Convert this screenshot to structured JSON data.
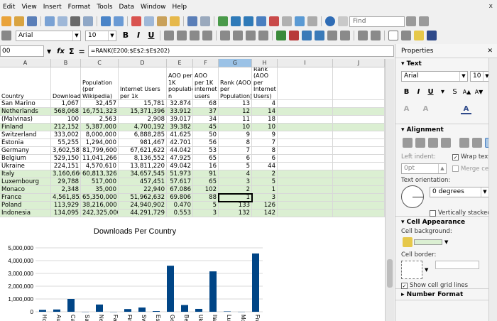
{
  "menu": [
    "Edit",
    "View",
    "Insert",
    "Format",
    "Tools",
    "Data",
    "Window",
    "Help"
  ],
  "window_controls": "x",
  "toolbar": {
    "find_placeholder": "Find",
    "font_name": "Arial",
    "font_size": "10"
  },
  "formula_bar": {
    "name_box": "00",
    "formula": "=RANK(E200;$E$2:$E$202)",
    "fx": "fx",
    "sigma": "Σ",
    "equals": "="
  },
  "sheet": {
    "columns": [
      "A",
      "B",
      "C",
      "D",
      "E",
      "F",
      "G",
      "H",
      "I",
      "J"
    ],
    "header_row": [
      "Country",
      "Downloads",
      "Population (per Wikipedia)",
      "Internet Users per 1k",
      "AOO per 1K populatio n",
      "AOO per 1K internet users",
      "Rank (AOO per Population)",
      "Rank (AOO per Internet Users)"
    ],
    "rows": [
      {
        "country": "San Marino",
        "downloads": "1,067",
        "population": "32,457",
        "internet": "15,781",
        "aoo_pop": "32.874",
        "aoo_net": "68",
        "rank_pop": "13",
        "rank_net": "4",
        "band": false
      },
      {
        "country": "Netherlands",
        "downloads": "568,068",
        "population": "16,751,323",
        "internet": "15,371,396",
        "aoo_pop": "33.912",
        "aoo_net": "37",
        "rank_pop": "12",
        "rank_net": "14",
        "band": true
      },
      {
        "country": "(Malvinas)",
        "downloads": "100",
        "population": "2,563",
        "internet": "2,908",
        "aoo_pop": "39.017",
        "aoo_net": "34",
        "rank_pop": "11",
        "rank_net": "18",
        "band": false
      },
      {
        "country": "Finland",
        "downloads": "212,152",
        "population": "5,387,000",
        "internet": "4,700,192",
        "aoo_pop": "39.382",
        "aoo_net": "45",
        "rank_pop": "10",
        "rank_net": "10",
        "band": true
      },
      {
        "country": "Switzerland",
        "downloads": "333,002",
        "population": "8,000,000",
        "internet": "6,888,285",
        "aoo_pop": "41.625",
        "aoo_net": "50",
        "rank_pop": "9",
        "rank_net": "9",
        "band": false
      },
      {
        "country": "Estonia",
        "downloads": "55,255",
        "population": "1,294,000",
        "internet": "981,467",
        "aoo_pop": "42.701",
        "aoo_net": "56",
        "rank_pop": "8",
        "rank_net": "7",
        "band": false
      },
      {
        "country": "Germany",
        "downloads": "3,602,587",
        "population": "81,799,600",
        "internet": "67,621,622",
        "aoo_pop": "44.042",
        "aoo_net": "53",
        "rank_pop": "7",
        "rank_net": "8",
        "band": false
      },
      {
        "country": "Belgium",
        "downloads": "529,150",
        "population": "11,041,266",
        "internet": "8,136,552",
        "aoo_pop": "47.925",
        "aoo_net": "65",
        "rank_pop": "6",
        "rank_net": "6",
        "band": false
      },
      {
        "country": "Ukraine",
        "downloads": "224,151",
        "population": "4,570,610",
        "internet": "13,811,220",
        "aoo_pop": "49.042",
        "aoo_net": "16",
        "rank_pop": "5",
        "rank_net": "44",
        "band": false
      },
      {
        "country": "Italy",
        "downloads": "3,160,660",
        "population": "60,813,326",
        "internet": "34,657,545",
        "aoo_pop": "51.973",
        "aoo_net": "91",
        "rank_pop": "4",
        "rank_net": "2",
        "band": true
      },
      {
        "country": "Luxembourg",
        "downloads": "29,788",
        "population": "517,000",
        "internet": "457,451",
        "aoo_pop": "57.617",
        "aoo_net": "65",
        "rank_pop": "3",
        "rank_net": "5",
        "band": true
      },
      {
        "country": "Monaco",
        "downloads": "2,348",
        "population": "35,000",
        "internet": "22,940",
        "aoo_pop": "67.086",
        "aoo_net": "102",
        "rank_pop": "2",
        "rank_net": "1",
        "band": true
      },
      {
        "country": "France",
        "downloads": "4,561,852",
        "population": "65,350,000",
        "internet": "51,962,632",
        "aoo_pop": "69.806",
        "aoo_net": "88",
        "rank_pop": "1",
        "rank_net": "3",
        "band": true
      },
      {
        "country": "Poland",
        "downloads": "113,929",
        "population": "38,216,000",
        "internet": "24,940,902",
        "aoo_pop": "0.470",
        "aoo_net": "5",
        "rank_pop": "133",
        "rank_net": "126",
        "band": true
      },
      {
        "country": "Indonesia",
        "downloads": "134,095",
        "population": "242,325,000",
        "internet": "44,291,729",
        "aoo_pop": "0.553",
        "aoo_net": "3",
        "rank_pop": "132",
        "rank_net": "142",
        "band": true
      }
    ]
  },
  "chart_data": {
    "type": "bar",
    "title": "Downloads Per Country",
    "categories": [
      "Hong",
      "Austr",
      "Carac",
      "San M",
      "Nethe",
      "Falkl",
      "Finlar",
      "Switz",
      "Eston",
      "Germ",
      "Belgi",
      "Ukrai",
      "Italy",
      "Luxer",
      "Mona",
      "Franc"
    ],
    "values": [
      150000,
      180000,
      1000000,
      1067,
      568068,
      100,
      212152,
      333002,
      55255,
      3602587,
      529150,
      224151,
      3160660,
      29788,
      2348,
      4561852
    ],
    "ylim": [
      0,
      5000000
    ],
    "yticks": [
      "0",
      "1,000,000",
      "2,000,000",
      "3,000,000",
      "4,000,000",
      "5,000,000"
    ],
    "grid": true,
    "color": "#004586"
  },
  "sidebar": {
    "title": "Properties",
    "text_section": "Text",
    "font_name": "Arial",
    "font_size": "10",
    "alignment_section": "Alignment",
    "left_indent_label": "Left indent:",
    "left_indent_value": "0pt",
    "wrap_text": "Wrap text",
    "merge_cells": "Merge cells",
    "text_orientation_label": "Text orientation:",
    "orientation_value": "0 degrees",
    "vertically_stacked": "Vertically stacked",
    "cell_appearance_section": "Cell Appearance",
    "cell_background_label": "Cell background:",
    "cell_border_label": "Cell border:",
    "show_grid_lines": "Show cell grid lines",
    "number_format_section": "Number Format"
  }
}
